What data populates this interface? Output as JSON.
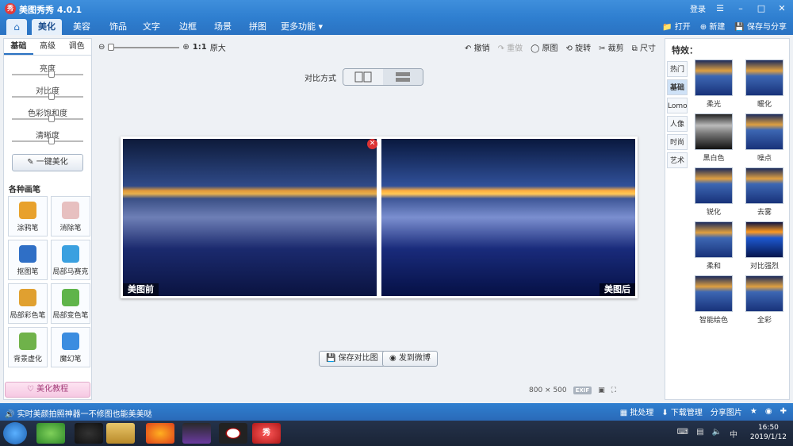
{
  "titlebar": {
    "title": "美图秀秀 4.0.1",
    "logo": "秀",
    "login": "登录"
  },
  "nav": {
    "tabs": [
      "美化",
      "美容",
      "饰品",
      "文字",
      "边框",
      "场景",
      "拼图",
      "更多功能"
    ],
    "active": "美化",
    "right": {
      "open": "打开",
      "new": "新建",
      "save_share": "保存与分享"
    }
  },
  "left": {
    "tabs": [
      "基础",
      "高级",
      "调色"
    ],
    "active": "基础",
    "sliders": [
      {
        "label": "亮度",
        "value": 0.55
      },
      {
        "label": "对比度",
        "value": 0.55
      },
      {
        "label": "色彩饱和度",
        "value": 0.55
      },
      {
        "label": "清晰度",
        "value": 0.55
      }
    ],
    "one_key": "一键美化",
    "brush_title": "各种画笔",
    "brushes": [
      {
        "label": "涂鸦笔",
        "color": "#e8a12c"
      },
      {
        "label": "消除笔",
        "color": "#e7c0c0"
      },
      {
        "label": "抠图笔",
        "color": "#2f6fc6"
      },
      {
        "label": "局部马赛克",
        "color": "#3aa0e0"
      },
      {
        "label": "局部彩色笔",
        "color": "#e0a030"
      },
      {
        "label": "局部变色笔",
        "color": "#5fb44a"
      },
      {
        "label": "背景虚化",
        "color": "#6fb24a"
      },
      {
        "label": "魔幻笔",
        "color": "#3c8de0"
      }
    ],
    "tutorial": "美化教程"
  },
  "toolbar": {
    "zoom_ratio": "1:1",
    "zoom_text": "原大",
    "tools": [
      {
        "label": "撤销",
        "disabled": false
      },
      {
        "label": "重做",
        "disabled": true
      },
      {
        "label": "原图",
        "disabled": false
      },
      {
        "label": "旋转",
        "disabled": false
      },
      {
        "label": "裁剪",
        "disabled": false
      },
      {
        "label": "尺寸",
        "disabled": false
      }
    ]
  },
  "compare": {
    "label": "对比方式"
  },
  "photos": {
    "before": "美图前",
    "after": "美图后"
  },
  "actions": {
    "save_compare": "保存对比图",
    "send_weibo": "发到微博"
  },
  "info": {
    "size": "800 × 500",
    "exif": "EXIF"
  },
  "effects": {
    "title": "特效：",
    "categories": [
      "热门",
      "基础",
      "Lomo",
      "人像",
      "时尚",
      "艺术"
    ],
    "active": "基础",
    "items": [
      {
        "label": "柔光",
        "style": ""
      },
      {
        "label": "暖化",
        "style": ""
      },
      {
        "label": "黑白色",
        "style": "bw"
      },
      {
        "label": "噪点",
        "style": ""
      },
      {
        "label": "锐化",
        "style": ""
      },
      {
        "label": "去雾",
        "style": ""
      },
      {
        "label": "柔和",
        "style": ""
      },
      {
        "label": "对比强烈",
        "style": "strong"
      },
      {
        "label": "智能绘色",
        "style": ""
      },
      {
        "label": "全彩",
        "style": ""
      }
    ]
  },
  "status": {
    "message": "实时美颜拍照神器一不修图也能美美哒",
    "batch": "批处理",
    "download": "下载管理",
    "share": "分享图片"
  },
  "taskbar": {
    "time": "16:50",
    "date": "2019/1/12",
    "app_label": "秀"
  }
}
